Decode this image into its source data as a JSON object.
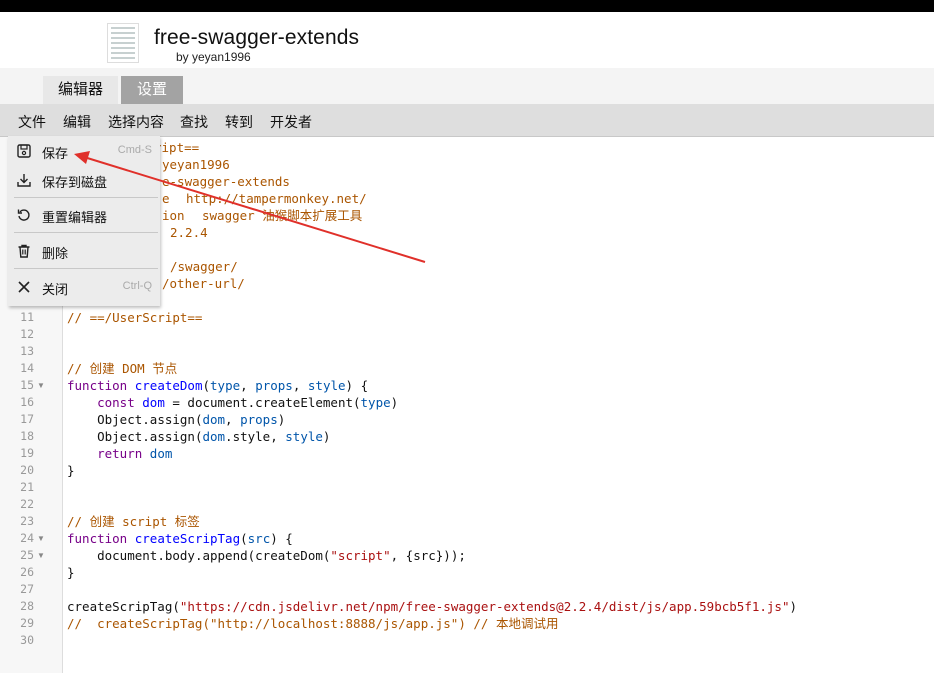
{
  "header": {
    "title": "free-swagger-extends",
    "author": "by yeyan1996"
  },
  "tabs": [
    {
      "label": "编辑器"
    },
    {
      "label": "设置"
    }
  ],
  "menubar": {
    "items": [
      "文件",
      "编辑",
      "选择内容",
      "查找",
      "转到",
      "开发者"
    ]
  },
  "dropdown": {
    "items": [
      {
        "label": "保存",
        "shortcut": "Cmd-S",
        "icon": "save-icon"
      },
      {
        "label": "保存到磁盘",
        "shortcut": "",
        "icon": "download-icon"
      },
      {
        "label": "重置编辑器",
        "shortcut": "",
        "icon": "reset-icon"
      },
      {
        "label": "删除",
        "shortcut": "",
        "icon": "trash-icon"
      },
      {
        "label": "关闭",
        "shortcut": "Ctrl-Q",
        "icon": "close-icon"
      }
    ]
  },
  "editor": {
    "visible_fragments": {
      "l1": "ript==",
      "l2": "yeyan1996",
      "l3": "e-swagger-extends",
      "l4a": "e",
      "l4b": "http://tampermonkey.net/",
      "l5a": "ion",
      "l5b": "swagger 油猴脚本扩展工具",
      "l6": "2.2.4",
      "l8": "/swagger/",
      "l9": "/other-url/"
    },
    "line_numbers": [
      "11",
      "12",
      "13",
      "14",
      "15",
      "16",
      "17",
      "18",
      "19",
      "20",
      "21",
      "22",
      "23",
      "24",
      "25",
      "26",
      "27",
      "28",
      "29",
      "30"
    ],
    "code": {
      "l11": "// ==/UserScript==",
      "l14": "// 创建 DOM 节点",
      "l15_kw": "function",
      "l15_fn": "createDom",
      "l15_p1": "type",
      "l15_p2": "props",
      "l15_p3": "style",
      "l16_kw": "const",
      "l16_v": "dom",
      "l16_rest": " = document.createElement(",
      "l16_arg": "type",
      "l17_a": "Object.assign(",
      "l17_b": "dom",
      "l17_c": "props",
      "l18_a": "Object.assign(",
      "l18_b": "dom",
      "l18_c": ".style, ",
      "l18_d": "style",
      "l19_kw": "return",
      "l19_v": "dom",
      "l20": "}",
      "l23": "// 创建 script 标签",
      "l24_kw": "function",
      "l24_fn": "createScripTag",
      "l24_p": "src",
      "l25_a": "document.body.append(createDom(",
      "l25_s": "\"script\"",
      "l25_b": ", {src}));",
      "l26": "}",
      "l28_a": "createScripTag(",
      "l28_s": "\"https://cdn.jsdelivr.net/npm/free-swagger-extends@2.2.4/dist/js/app.59bcb5f1.js\"",
      "l28_b": ")",
      "l29": "//  createScripTag(\"http://localhost:8888/js/app.js\") // 本地调试用"
    }
  },
  "colors": {
    "comment": "#aa5500",
    "keyword": "#770088",
    "function": "#0000ff",
    "variable": "#0055aa",
    "string": "#aa1111",
    "annotation_arrow": "#e0302a",
    "settings_tab": "#a3a3a3"
  }
}
